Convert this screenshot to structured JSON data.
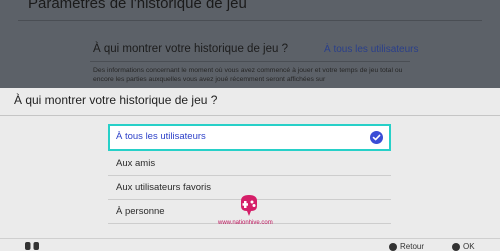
{
  "background": {
    "title": "Paramètres de l'historique de jeu",
    "question": "À qui montrer votre historique de jeu ?",
    "current_value": "À tous les utilisateurs",
    "description": "Des informations concernant le moment où vous avez commencé à jouer et votre temps de jeu total ou encore les parties auxquelles vous avez joué récemment seront affichées sur"
  },
  "modal": {
    "title": "À qui montrer votre historique de jeu ?",
    "options": [
      {
        "label": "À tous les utilisateurs",
        "selected": true
      },
      {
        "label": "Aux amis",
        "selected": false
      },
      {
        "label": "Aux utilisateurs favoris",
        "selected": false
      },
      {
        "label": "À personne",
        "selected": false
      }
    ]
  },
  "watermark": {
    "text": "www.nationhive.com"
  },
  "footer": {
    "back_label": "Retour",
    "ok_label": "OK"
  },
  "colors": {
    "accent": "#3a4dd6",
    "focus": "#27d0c8",
    "brand": "#c0175f"
  }
}
